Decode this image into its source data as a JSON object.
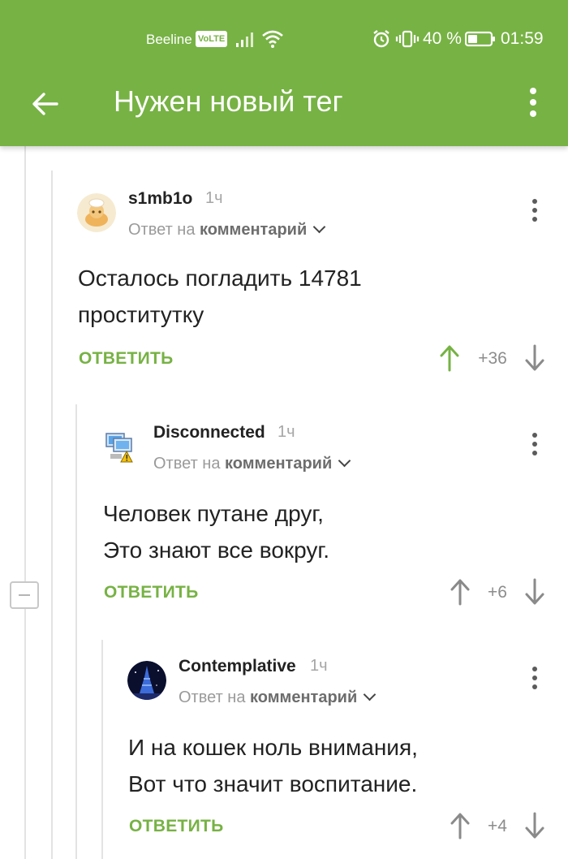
{
  "status_bar": {
    "carrier": "Beeline",
    "volte": "VoLTE",
    "battery_percent": "40 %",
    "time": "01:59"
  },
  "toolbar": {
    "title": "Нужен новый тег"
  },
  "comments": [
    {
      "author": "s1mb1o",
      "time": "1ч",
      "reply_prefix": "Ответ на",
      "reply_target": "комментарий",
      "text_lines": [
        "Осталось погладить 14781",
        "проститутку"
      ],
      "reply_label": "ОТВЕТИТЬ",
      "score": "+36",
      "upvoted": true
    },
    {
      "author": "Disconnected",
      "time": "1ч",
      "reply_prefix": "Ответ на",
      "reply_target": "комментарий",
      "text_lines": [
        "Человек путане друг,",
        "Это знают все вокруг."
      ],
      "reply_label": "ОТВЕТИТЬ",
      "score": "+6",
      "upvoted": false
    },
    {
      "author": "Contemplative",
      "time": "1ч",
      "reply_prefix": "Ответ на",
      "reply_target": "комментарий",
      "text_lines": [
        "И на кошек ноль внимания,",
        "Вот что значит воспитание."
      ],
      "reply_label": "ОТВЕТИТЬ",
      "score": "+4",
      "upvoted": false
    }
  ],
  "colors": {
    "brand_green": "#77b244",
    "upvote_active": "#77b244",
    "vote_inactive": "#8a8a8a"
  },
  "icons": [
    "back-arrow-icon",
    "more-vert-icon",
    "alarm-icon",
    "vibrate-icon",
    "battery-icon",
    "wifi-icon",
    "signal-icon",
    "chevron-down-icon",
    "arrow-up-icon",
    "arrow-down-icon",
    "collapse-minus-icon"
  ]
}
